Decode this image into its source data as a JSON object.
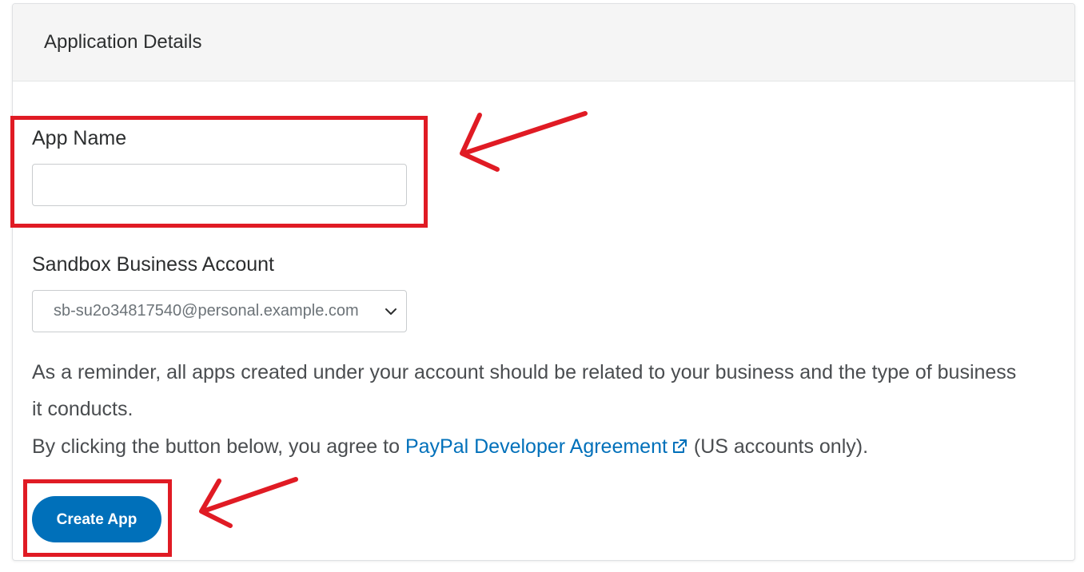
{
  "card": {
    "title": "Application Details"
  },
  "app_name": {
    "label": "App Name",
    "value": "",
    "placeholder": ""
  },
  "sandbox_account": {
    "label": "Sandbox Business Account",
    "selected": "sb-su2o34817540@personal.example.com"
  },
  "reminder": {
    "line1": "As a reminder, all apps created under your account should be related to your business and the type of business",
    "line2": "it conducts.",
    "agreement_prefix": "By clicking the button below, you agree to ",
    "agreement_link": "PayPal Developer Agreement",
    "agreement_suffix": " (US accounts only)."
  },
  "actions": {
    "create_label": "Create App"
  },
  "icons": {
    "select_chevron": "chevron-down-icon",
    "external_link": "external-link-icon"
  },
  "colors": {
    "brand_blue": "#0070ba",
    "annotation_red": "#e01b24",
    "header_bg": "#f5f5f5"
  }
}
